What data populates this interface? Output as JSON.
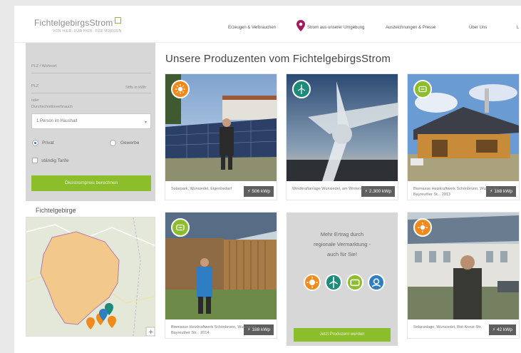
{
  "logo": {
    "name_grey": "FichtelgebirgsStrom",
    "name_green": "",
    "tagline": "VON HIER. FÜR HIER. FÜR MORGEN"
  },
  "nav": {
    "items": [
      "Erzeugen & Verbrauchen",
      "Strom aus unserer Umgebung",
      "Auszeichnungen & Presse",
      "Über Uns",
      "L"
    ]
  },
  "form": {
    "field1_label": "PLZ / Wohnort",
    "field2_label": "PLZ",
    "field2_hint": "Stffs in kWh",
    "field3_label": "oder",
    "field3_sub": "Durchschnittsverbrauch",
    "select_value": "1 Person im Haushalt",
    "radio_privat": "Privat",
    "radio_gewerbe": "Gewerbe",
    "checkbox_label": "ständig Tarife",
    "cta_label": "Ökostrompreis berechnen"
  },
  "map": {
    "title": "Fichtelgebirge"
  },
  "main": {
    "heading": "Unsere Produzenten vom FichtelgebirgsStrom",
    "cards": [
      {
        "caption": "Solarpark, Wunsiedel, Eigenbedarf",
        "kw": "506 kWp",
        "badge": "sun"
      },
      {
        "caption": "Windkraftanlage Wunsiedel, am Wintersberg",
        "kw": "2.300 kWp",
        "badge": "wind"
      },
      {
        "caption": "Biomasse Heizkraftwerk Schönbrunn, Wunsiedel, Bayreuther St... 2013",
        "kw": "188 kWp",
        "badge": "biomass"
      },
      {
        "caption": "Biomasse Heizkraftwerk Schönbrunn, Wunsiedel, Bayreuther Str... 2014",
        "kw": "188 kWp",
        "badge": "biomass"
      },
      {
        "caption": "Solaranlage, Wunsiedel, Rot-Kreuz-Str.",
        "kw": "42 kWp",
        "badge": "sun"
      }
    ],
    "promo": {
      "line1": "Mehr Ertrag durch",
      "line2": "regionale Vermarktung -",
      "line3": "auch für Sie!",
      "button": "Jetzt Produzent werden"
    }
  },
  "colors": {
    "accent_green": "#8cbd2a",
    "solar_orange": "#f08a1c",
    "wind_teal": "#1d8a7a",
    "biomass_green": "#8cbd2a",
    "water_blue": "#2d7fc1"
  }
}
